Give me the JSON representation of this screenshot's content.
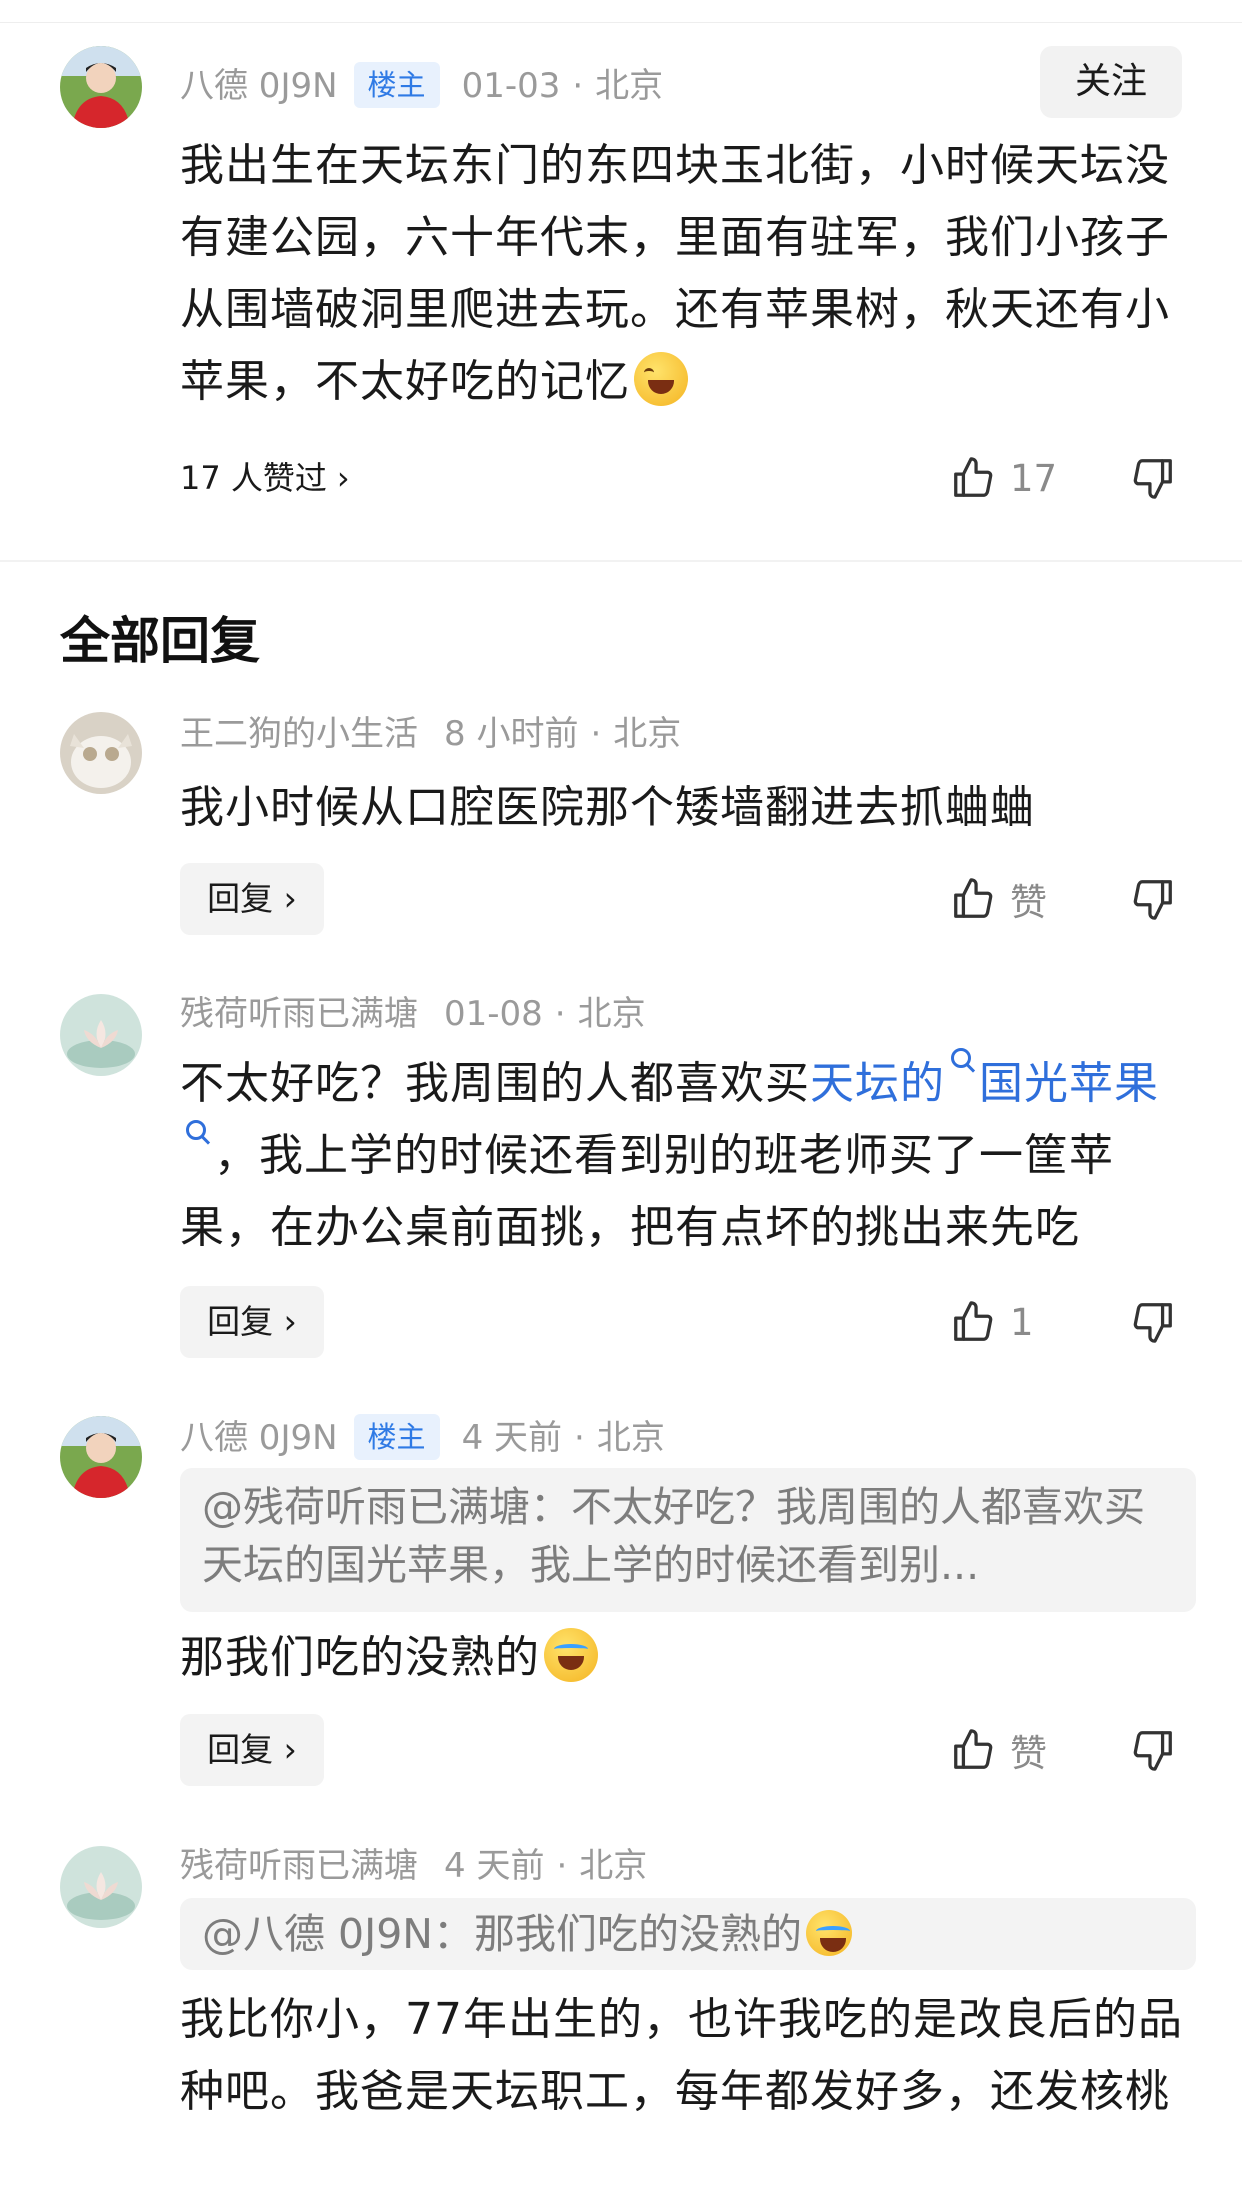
{
  "comment": {
    "author": "八德 0J9N",
    "badge": "楼主",
    "date": "01-03",
    "location": "北京",
    "follow_label": "关注",
    "text": "我出生在天坛东门的东四块玉北街，小时候天坛没有建公园，六十年代末，里面有驻军，我们小孩子从围墙破洞里爬进去玩。还有苹果树，秋天还有小苹果，不太好吃的记忆",
    "liked_by": "17 人赞过",
    "like_count": "17"
  },
  "section_title": "全部回复",
  "replies": [
    {
      "author": "王二狗的小生活",
      "time": "8 小时前",
      "location": "北京",
      "text": "我小时候从口腔医院那个矮墙翻进去抓蛐蛐",
      "reply_label": "回复 ›",
      "like_label": "赞"
    },
    {
      "author": "残荷听雨已满塘",
      "time": "01-08",
      "location": "北京",
      "text_before": "不太好吃？我周围的人都喜欢买",
      "link1": "天坛的",
      "link2": "国光苹果",
      "text_after": "，我上学的时候还看到别的班老师买了一筐苹果，在办公桌前面挑，把有点坏的挑出来先吃",
      "reply_label": "回复 ›",
      "like_label": "1"
    },
    {
      "author": "八德 0J9N",
      "badge": "楼主",
      "time": "4 天前",
      "location": "北京",
      "quote": "@残荷听雨已满塘：不太好吃？我周围的人都喜欢买天坛的国光苹果，我上学的时候还看到别...",
      "text": "那我们吃的没熟的",
      "reply_label": "回复 ›",
      "like_label": "赞"
    },
    {
      "author": "残荷听雨已满塘",
      "time": "4 天前",
      "location": "北京",
      "quote": "@八德 0J9N：那我们吃的没熟的",
      "text": "我比你小，77年出生的，也许我吃的是改良后的品种吧。我爸是天坛职工，每年都发好多，还发核桃"
    }
  ],
  "dot": "·",
  "colors": {
    "accent": "#2f6fdb",
    "badge_bg": "#e8f1fd",
    "meta": "#9a9a9a"
  }
}
